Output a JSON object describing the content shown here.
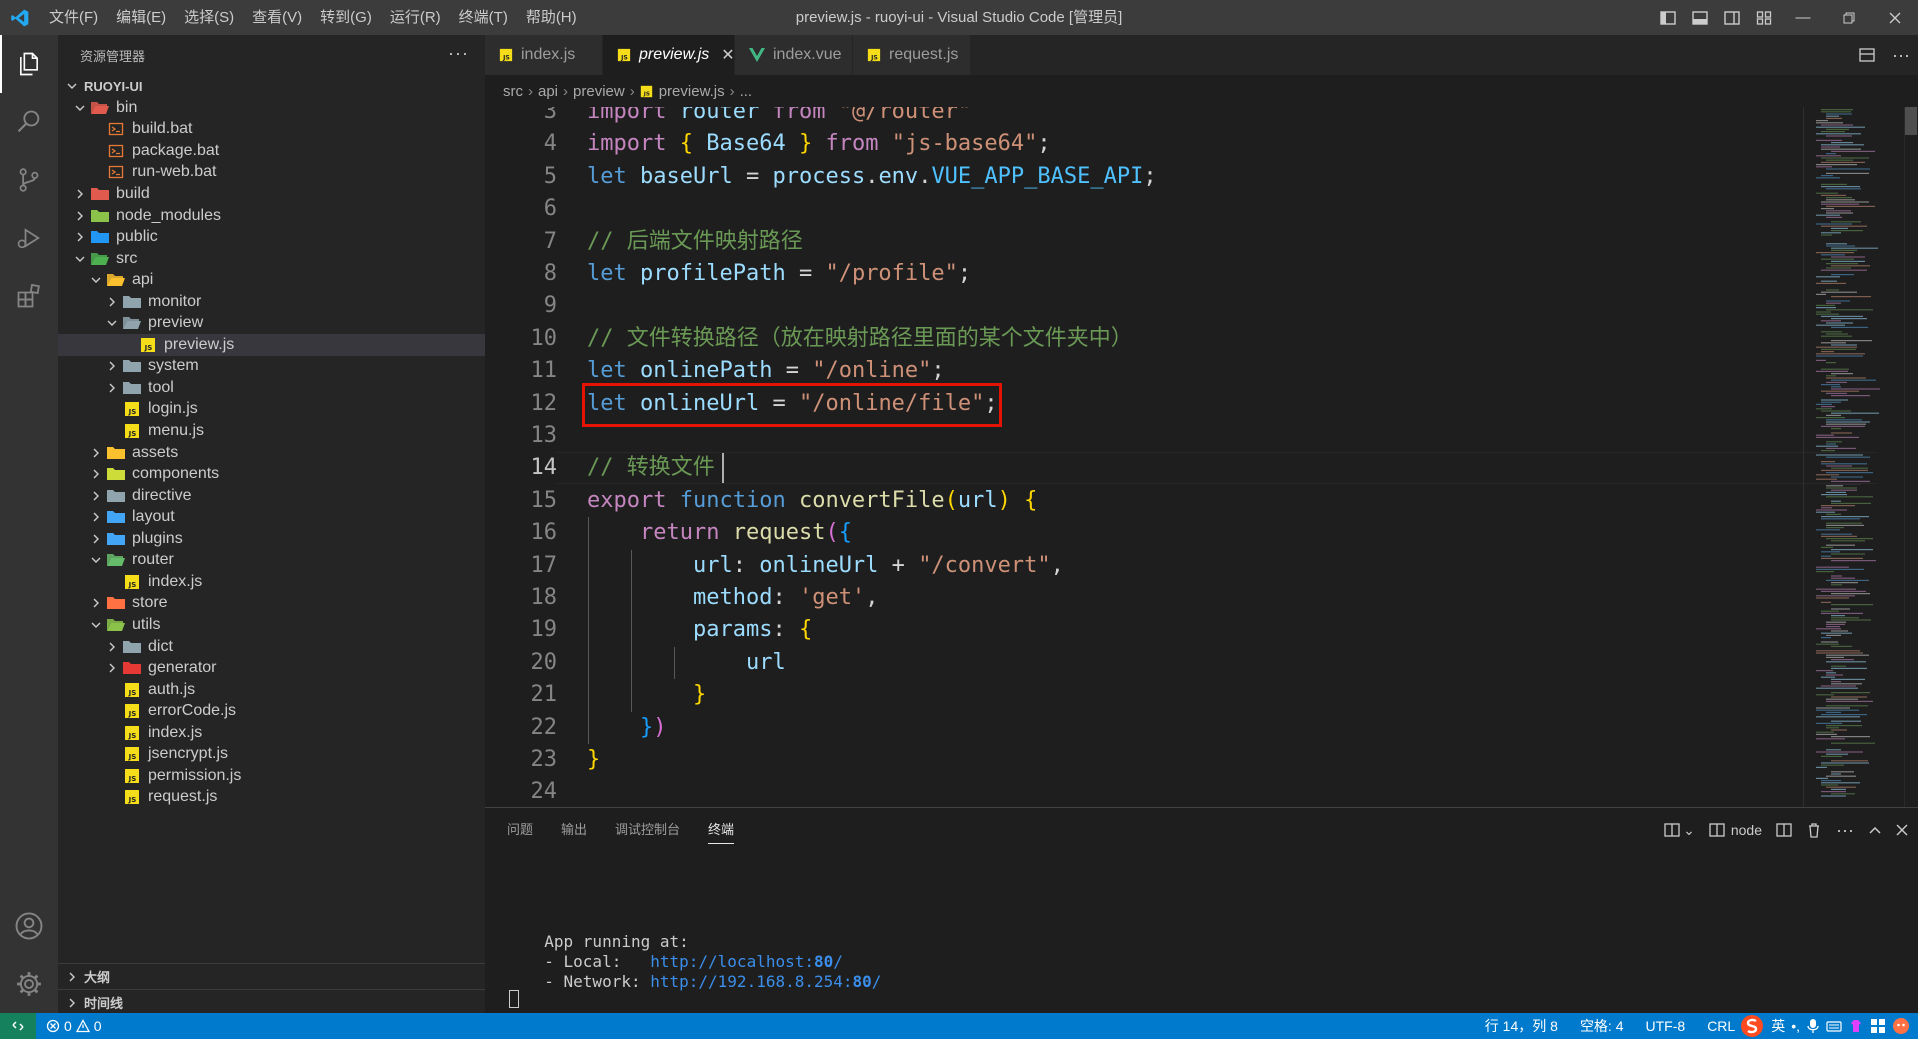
{
  "window": {
    "title": "preview.js - ruoyi-ui - Visual Studio Code [管理员]"
  },
  "menu": [
    "文件(F)",
    "编辑(E)",
    "选择(S)",
    "查看(V)",
    "转到(G)",
    "运行(R)",
    "终端(T)",
    "帮助(H)"
  ],
  "explorer": {
    "header": "资源管理器",
    "root": "RUOYI-UI",
    "items": [
      {
        "label": "bin",
        "depth": 1,
        "type": "folder",
        "open": true,
        "icon": "bin-folder-icon",
        "color": "#e05a4e"
      },
      {
        "label": "build.bat",
        "depth": 2,
        "type": "file",
        "icon": "bat-file-icon",
        "color": "#e37933"
      },
      {
        "label": "package.bat",
        "depth": 2,
        "type": "file",
        "icon": "bat-file-icon",
        "color": "#e37933"
      },
      {
        "label": "run-web.bat",
        "depth": 2,
        "type": "file",
        "icon": "bat-file-icon",
        "color": "#e37933"
      },
      {
        "label": "build",
        "depth": 1,
        "type": "folder",
        "open": false,
        "icon": "build-folder-icon",
        "color": "#e05a4e"
      },
      {
        "label": "node_modules",
        "depth": 1,
        "type": "folder",
        "open": false,
        "icon": "node-folder-icon",
        "color": "#8bc34a"
      },
      {
        "label": "public",
        "depth": 1,
        "type": "folder",
        "open": false,
        "icon": "public-folder-icon",
        "color": "#2196f3"
      },
      {
        "label": "src",
        "depth": 1,
        "type": "folder",
        "open": true,
        "icon": "src-folder-icon",
        "color": "#4caf50"
      },
      {
        "label": "api",
        "depth": 2,
        "type": "folder",
        "open": true,
        "icon": "api-folder-icon",
        "color": "#fbc02d"
      },
      {
        "label": "monitor",
        "depth": 3,
        "type": "folder",
        "open": false,
        "icon": "folder-icon",
        "color": "#90a4ae"
      },
      {
        "label": "preview",
        "depth": 3,
        "type": "folder",
        "open": true,
        "icon": "folder-icon",
        "color": "#90a4ae"
      },
      {
        "label": "preview.js",
        "depth": 4,
        "type": "file",
        "icon": "js-file-icon",
        "color": "#f5de19",
        "selected": true
      },
      {
        "label": "system",
        "depth": 3,
        "type": "folder",
        "open": false,
        "icon": "folder-icon",
        "color": "#90a4ae"
      },
      {
        "label": "tool",
        "depth": 3,
        "type": "folder",
        "open": false,
        "icon": "folder-icon",
        "color": "#90a4ae"
      },
      {
        "label": "login.js",
        "depth": 3,
        "type": "file",
        "icon": "js-file-icon",
        "color": "#f5de19"
      },
      {
        "label": "menu.js",
        "depth": 3,
        "type": "file",
        "icon": "js-file-icon",
        "color": "#f5de19"
      },
      {
        "label": "assets",
        "depth": 2,
        "type": "folder",
        "open": false,
        "icon": "assets-folder-icon",
        "color": "#fbc02d"
      },
      {
        "label": "components",
        "depth": 2,
        "type": "folder",
        "open": false,
        "icon": "components-folder-icon",
        "color": "#cddc39"
      },
      {
        "label": "directive",
        "depth": 2,
        "type": "folder",
        "open": false,
        "icon": "folder-icon",
        "color": "#90a4ae"
      },
      {
        "label": "layout",
        "depth": 2,
        "type": "folder",
        "open": false,
        "icon": "layout-folder-icon",
        "color": "#42a5f5"
      },
      {
        "label": "plugins",
        "depth": 2,
        "type": "folder",
        "open": false,
        "icon": "plugins-folder-icon",
        "color": "#42a5f5"
      },
      {
        "label": "router",
        "depth": 2,
        "type": "folder",
        "open": true,
        "icon": "router-folder-icon",
        "color": "#66bb6a"
      },
      {
        "label": "index.js",
        "depth": 3,
        "type": "file",
        "icon": "js-file-icon",
        "color": "#f5de19"
      },
      {
        "label": "store",
        "depth": 2,
        "type": "folder",
        "open": false,
        "icon": "store-folder-icon",
        "color": "#ff7043"
      },
      {
        "label": "utils",
        "depth": 2,
        "type": "folder",
        "open": true,
        "icon": "utils-folder-icon",
        "color": "#8bc34a"
      },
      {
        "label": "dict",
        "depth": 3,
        "type": "folder",
        "open": false,
        "icon": "folder-icon",
        "color": "#90a4ae"
      },
      {
        "label": "generator",
        "depth": 3,
        "type": "folder",
        "open": false,
        "icon": "generator-folder-icon",
        "color": "#e53935"
      },
      {
        "label": "auth.js",
        "depth": 3,
        "type": "file",
        "icon": "js-file-icon",
        "color": "#f5de19"
      },
      {
        "label": "errorCode.js",
        "depth": 3,
        "type": "file",
        "icon": "js-file-icon",
        "color": "#f5de19"
      },
      {
        "label": "index.js",
        "depth": 3,
        "type": "file",
        "icon": "js-file-icon",
        "color": "#f5de19"
      },
      {
        "label": "jsencrypt.js",
        "depth": 3,
        "type": "file",
        "icon": "js-file-icon",
        "color": "#f5de19"
      },
      {
        "label": "permission.js",
        "depth": 3,
        "type": "file",
        "icon": "js-file-icon",
        "color": "#f5de19"
      },
      {
        "label": "request.js",
        "depth": 3,
        "type": "file",
        "icon": "js-file-icon",
        "color": "#f5de19"
      }
    ],
    "outline": "大纲",
    "timeline": "时间线"
  },
  "tabs": [
    {
      "label": "index.js",
      "icon": "js-file-icon",
      "active": false
    },
    {
      "label": "preview.js",
      "icon": "js-file-icon",
      "active": true
    },
    {
      "label": "index.vue",
      "icon": "vue-file-icon",
      "active": false
    },
    {
      "label": "request.js",
      "icon": "js-file-icon",
      "active": false
    }
  ],
  "breadcrumb": [
    "src",
    "api",
    "preview",
    "preview.js",
    "..."
  ],
  "editor": {
    "current_line": 14,
    "lines": [
      {
        "n": "3",
        "html": "<span class='k'>import</span> <span class='v'>router</span> <span class='k'>from</span> <span class='s'>\"@/router\"</span>"
      },
      {
        "n": "4",
        "html": "<span class='k'>import</span> <span class='br1'>{</span> <span class='v'>Base64</span> <span class='br1'>}</span> <span class='k'>from</span> <span class='s'>\"js-base64\"</span>;"
      },
      {
        "n": "5",
        "html": "<span class='kw'>let</span> <span class='v'>baseUrl</span> = <span class='v'>process</span>.<span class='v'>env</span>.<span class='cn'>VUE_APP_BASE_API</span>;"
      },
      {
        "n": "6",
        "html": ""
      },
      {
        "n": "7",
        "html": "<span class='c'>// 后端文件映射路径</span>"
      },
      {
        "n": "8",
        "html": "<span class='kw'>let</span> <span class='v'>profilePath</span> = <span class='s'>\"/profile\"</span>;"
      },
      {
        "n": "9",
        "html": ""
      },
      {
        "n": "10",
        "html": "<span class='c'>// 文件转换路径（放在映射路径里面的某个文件夹中）</span>"
      },
      {
        "n": "11",
        "html": "<span class='kw'>let</span> <span class='v'>onlinePath</span> = <span class='s'>\"/online\"</span>;"
      },
      {
        "n": "12",
        "html": "<span class='kw'>let</span> <span class='v'>onlineUrl</span> = <span class='s'>\"/online/file\"</span>;"
      },
      {
        "n": "13",
        "html": ""
      },
      {
        "n": "14",
        "html": "<span class='c'>// 转换文件</span>"
      },
      {
        "n": "15",
        "html": "<span class='k'>export</span> <span class='kw'>function</span> <span class='f'>convertFile</span><span class='br1'>(</span><span class='v'>url</span><span class='br1'>)</span> <span class='br1'>{</span>"
      },
      {
        "n": "16",
        "html": "    <span class='k'>return</span> <span class='f'>request</span><span class='br2'>(</span><span class='br3'>{</span>"
      },
      {
        "n": "17",
        "html": "        <span class='v'>url</span>: <span class='v'>onlineUrl</span> + <span class='s'>\"/convert\"</span>,"
      },
      {
        "n": "18",
        "html": "        <span class='v'>method</span>: <span class='s'>'get'</span>,"
      },
      {
        "n": "19",
        "html": "        <span class='v'>params</span>: <span class='br1'>{</span>"
      },
      {
        "n": "20",
        "html": "            <span class='v'>url</span>"
      },
      {
        "n": "21",
        "html": "        <span class='br1'>}</span>"
      },
      {
        "n": "22",
        "html": "    <span class='br3'>}</span><span class='br2'>)</span>"
      },
      {
        "n": "23",
        "html": "<span class='br1'>}</span>"
      },
      {
        "n": "24",
        "html": ""
      }
    ]
  },
  "panel": {
    "tabs": [
      {
        "label": "问题",
        "active": false
      },
      {
        "label": "输出",
        "active": false
      },
      {
        "label": "调试控制台",
        "active": false
      },
      {
        "label": "终端",
        "active": true
      }
    ],
    "terminal_name": "node",
    "terminal": {
      "heading": "  App running at:",
      "local_label": "  - Local:   ",
      "local_url": "http://localhost:",
      "local_port": "80",
      "network_label": "  - Network: ",
      "network_url": "http://192.168.8.254:",
      "network_port": "80",
      "slash": "/"
    }
  },
  "status": {
    "errors": "0",
    "warnings": "0",
    "position": "行 14，列 8",
    "spaces": "空格: 4",
    "encoding": "UTF-8",
    "eol": "CRL",
    "ime_lang": "英"
  },
  "colors": {
    "accent": "#007acc",
    "highlight_box": "#e51400",
    "js_icon": "#f5de19",
    "vue_icon": "#41b883"
  }
}
